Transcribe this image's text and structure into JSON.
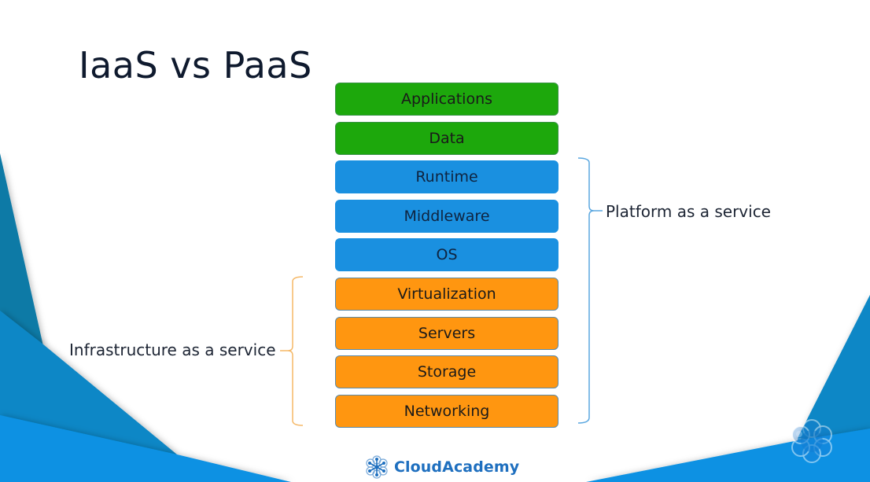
{
  "slide": {
    "title": "IaaS vs PaaS",
    "layers": [
      {
        "label": "Applications",
        "color": "green"
      },
      {
        "label": "Data",
        "color": "green"
      },
      {
        "label": "Runtime",
        "color": "blue"
      },
      {
        "label": "Middleware",
        "color": "blue"
      },
      {
        "label": "OS",
        "color": "blue"
      },
      {
        "label": "Virtualization",
        "color": "orange"
      },
      {
        "label": "Servers",
        "color": "orange"
      },
      {
        "label": "Storage",
        "color": "orange"
      },
      {
        "label": "Networking",
        "color": "orange"
      }
    ],
    "groups": {
      "paas": {
        "label": "Platform as a service",
        "covers": [
          "Runtime",
          "Middleware",
          "OS",
          "Virtualization",
          "Servers",
          "Storage",
          "Networking"
        ],
        "color": "#5aa7e0"
      },
      "iaas": {
        "label": "Infrastructure as a service",
        "covers": [
          "Virtualization",
          "Servers",
          "Storage",
          "Networking"
        ],
        "color": "#f5b867"
      }
    },
    "colors": {
      "green": "#1da80c",
      "blue": "#1a90e0",
      "orange": "#ff9610",
      "background_dark": "#0f7aa6",
      "background_mid": "#1187c6",
      "background_light": "#0891e3"
    }
  },
  "footer": {
    "brand": "CloudAcademy"
  }
}
